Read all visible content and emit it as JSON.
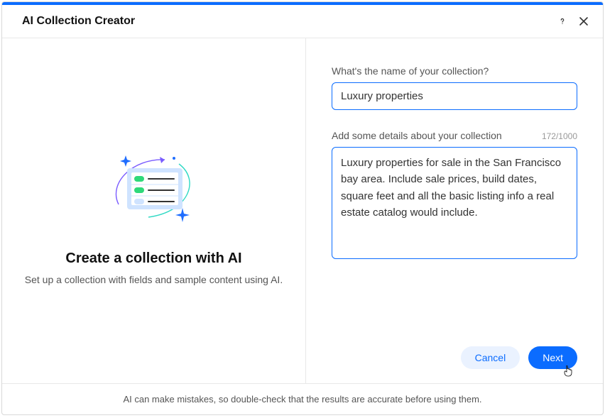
{
  "header": {
    "title": "AI Collection Creator"
  },
  "left": {
    "heading": "Create a collection with AI",
    "subheading": "Set up a collection with fields and sample content using AI."
  },
  "form": {
    "name_label": "What's the name of your collection?",
    "name_value": "Luxury properties",
    "details_label": "Add some details about your collection",
    "details_value": "Luxury properties for sale in the San Francisco bay area. Include sale prices, build dates, square feet and all the basic listing info a real estate catalog would include.",
    "char_count": "172/1000"
  },
  "actions": {
    "cancel_label": "Cancel",
    "next_label": "Next"
  },
  "footer": {
    "disclaimer": "AI can make mistakes, so double-check that the results are accurate before using them."
  }
}
